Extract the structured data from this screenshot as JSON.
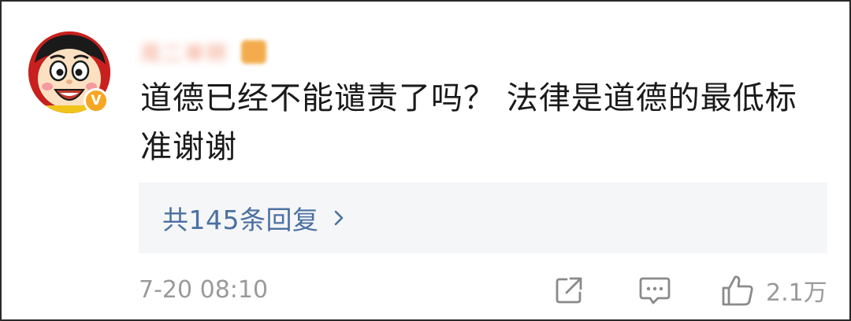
{
  "post": {
    "username": "周二单转",
    "comment_text": "道德已经不能谴责了吗？ 法律是道德的最低标准谢谢",
    "verified_mark": "V",
    "timestamp": "7-20 08:10",
    "like_count": "2.1万"
  },
  "replies": {
    "label": "共145条回复"
  },
  "colors": {
    "link_blue": "#4b70a1",
    "meta_gray": "#9a9a9a",
    "panel_bg": "#f5f6f8",
    "verified_orange": "#f5a623"
  },
  "icons": {
    "share": "share-icon",
    "comment": "comment-icon",
    "like": "thumbs-up-icon",
    "chevron": "chevron-right-icon"
  }
}
